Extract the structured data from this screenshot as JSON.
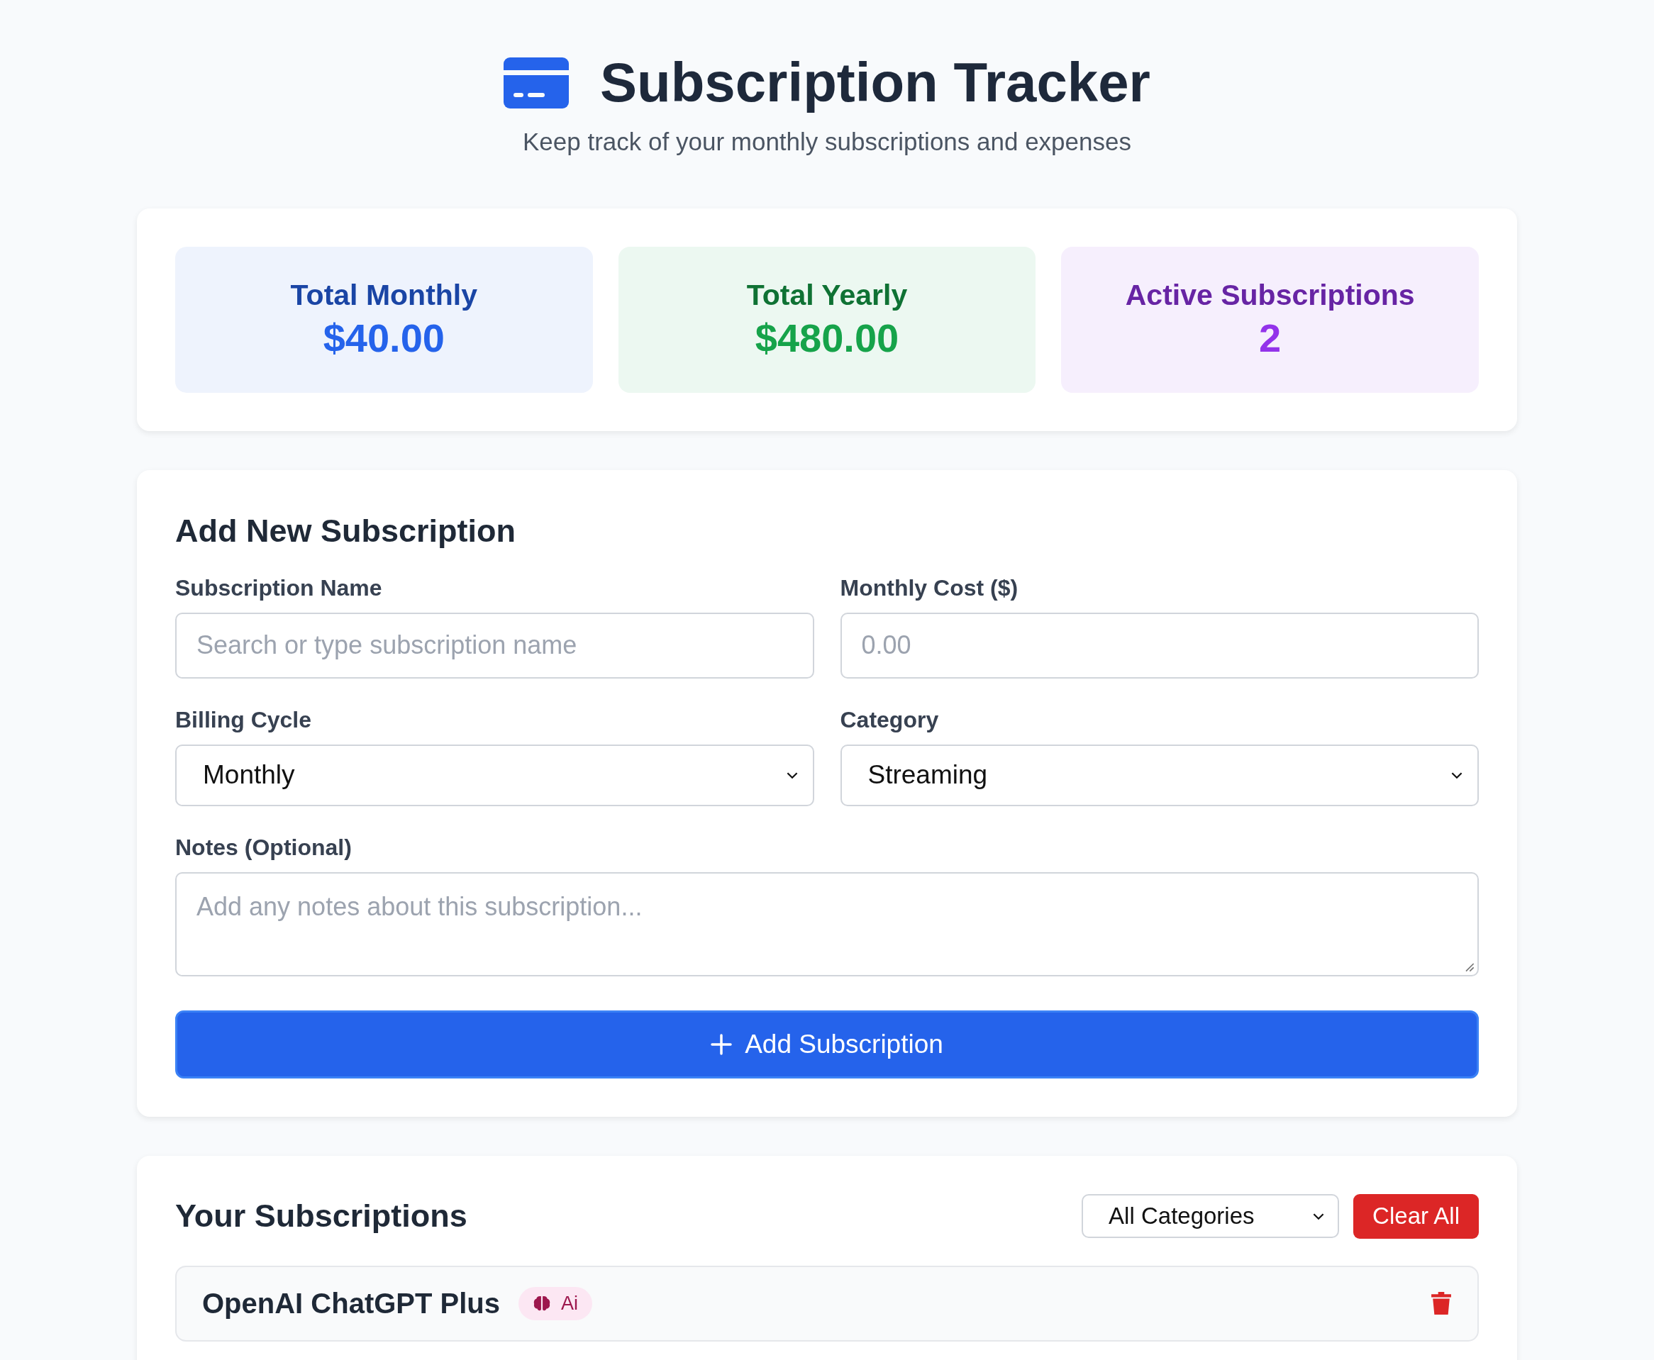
{
  "header": {
    "title": "Subscription Tracker",
    "subtitle": "Keep track of your monthly subscriptions and expenses"
  },
  "stats": [
    {
      "label": "Total Monthly",
      "value": "$40.00",
      "color": "#2563eb"
    },
    {
      "label": "Total Yearly",
      "value": "$480.00",
      "color": "#16a34a"
    },
    {
      "label": "Active Subscriptions",
      "value": "2",
      "color": "#9333ea"
    }
  ],
  "form": {
    "title": "Add New Subscription",
    "fields": [
      {
        "kind": "input",
        "label": "Subscription Name",
        "placeholder": "Search or type subscription name"
      },
      {
        "kind": "input",
        "label": "Monthly Cost ($)",
        "placeholder": "0.00"
      },
      {
        "kind": "select",
        "label": "Billing Cycle",
        "value": "Monthly"
      },
      {
        "kind": "select",
        "label": "Category",
        "value": "Streaming"
      },
      {
        "kind": "textarea",
        "label": "Notes (Optional)",
        "placeholder": "Add any notes about this subscription..."
      }
    ],
    "submit": "Add Subscription"
  },
  "list": {
    "title": "Your Subscriptions",
    "filter": "All Categories",
    "clear": "Clear All",
    "items": [
      {
        "name": "OpenAI ChatGPT Plus",
        "category": "Ai"
      }
    ]
  }
}
